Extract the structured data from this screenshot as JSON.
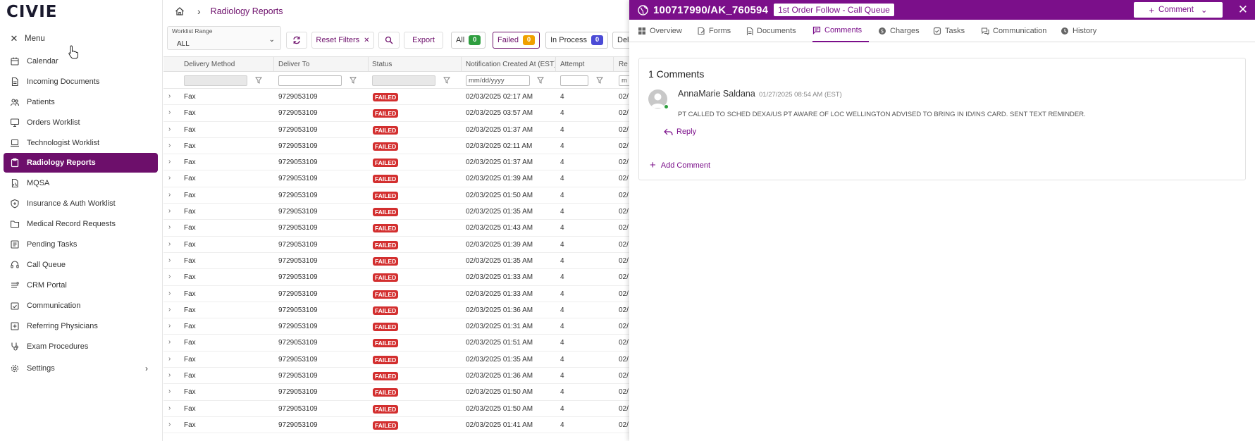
{
  "sidebar": {
    "logo": "CIVIE",
    "menu_label": "Menu",
    "items": [
      {
        "label": "Calendar",
        "icon": "calendar-icon"
      },
      {
        "label": "Incoming Documents",
        "icon": "document-icon"
      },
      {
        "label": "Patients",
        "icon": "users-icon"
      },
      {
        "label": "Orders Worklist",
        "icon": "monitor-icon"
      },
      {
        "label": "Technologist Worklist",
        "icon": "laptop-icon"
      },
      {
        "label": "Radiology Reports",
        "icon": "clipboard-icon",
        "active": true
      },
      {
        "label": "MQSA",
        "icon": "file-chart-icon"
      },
      {
        "label": "Insurance & Auth Worklist",
        "icon": "shield-icon"
      },
      {
        "label": "Medical Record Requests",
        "icon": "folder-icon"
      },
      {
        "label": "Pending Tasks",
        "icon": "list-icon"
      },
      {
        "label": "Call Queue",
        "icon": "headset-icon"
      },
      {
        "label": "CRM Portal",
        "icon": "portal-icon"
      },
      {
        "label": "Communication",
        "icon": "calendar-check-icon"
      },
      {
        "label": "Referring Physicians",
        "icon": "plus-square-icon"
      },
      {
        "label": "Exam Procedures",
        "icon": "stethoscope-icon"
      },
      {
        "label": "Settings",
        "icon": "gear-icon"
      }
    ]
  },
  "header": {
    "title": "Radiology Reports"
  },
  "filters": {
    "worklist_range_label": "Worklist Range",
    "worklist_range_value": "ALL",
    "reset_label": "Reset Filters",
    "export_label": "Export",
    "chips": [
      {
        "label": "All",
        "count": "0",
        "color": "#2e9e3f"
      },
      {
        "label": "Failed",
        "count": "0",
        "color": "#f0a000"
      },
      {
        "label": "In Process",
        "count": "0",
        "color": "#4b4bd6"
      },
      {
        "label": "Del",
        "count": ""
      }
    ]
  },
  "table": {
    "columns": [
      "Delivery Method",
      "Deliver To",
      "Status",
      "Notification Created At (EST)",
      "Attempt",
      "Re"
    ],
    "date_placeholder": "mm/dd/yyyy",
    "partial_filter": "m",
    "rows": [
      {
        "method": "Fax",
        "to": "9729053109",
        "status": "FAILED",
        "created": "02/03/2025 02:17 AM",
        "attempt": "4",
        "extra": "02/"
      },
      {
        "method": "Fax",
        "to": "9729053109",
        "status": "FAILED",
        "created": "02/03/2025 03:57 AM",
        "attempt": "4",
        "extra": "02/"
      },
      {
        "method": "Fax",
        "to": "9729053109",
        "status": "FAILED",
        "created": "02/03/2025 01:37 AM",
        "attempt": "4",
        "extra": "02/"
      },
      {
        "method": "Fax",
        "to": "9729053109",
        "status": "FAILED",
        "created": "02/03/2025 02:11 AM",
        "attempt": "4",
        "extra": "02/"
      },
      {
        "method": "Fax",
        "to": "9729053109",
        "status": "FAILED",
        "created": "02/03/2025 01:37 AM",
        "attempt": "4",
        "extra": "02/"
      },
      {
        "method": "Fax",
        "to": "9729053109",
        "status": "FAILED",
        "created": "02/03/2025 01:39 AM",
        "attempt": "4",
        "extra": "02/"
      },
      {
        "method": "Fax",
        "to": "9729053109",
        "status": "FAILED",
        "created": "02/03/2025 01:50 AM",
        "attempt": "4",
        "extra": "02/"
      },
      {
        "method": "Fax",
        "to": "9729053109",
        "status": "FAILED",
        "created": "02/03/2025 01:35 AM",
        "attempt": "4",
        "extra": "02/"
      },
      {
        "method": "Fax",
        "to": "9729053109",
        "status": "FAILED",
        "created": "02/03/2025 01:43 AM",
        "attempt": "4",
        "extra": "02/"
      },
      {
        "method": "Fax",
        "to": "9729053109",
        "status": "FAILED",
        "created": "02/03/2025 01:39 AM",
        "attempt": "4",
        "extra": "02/"
      },
      {
        "method": "Fax",
        "to": "9729053109",
        "status": "FAILED",
        "created": "02/03/2025 01:35 AM",
        "attempt": "4",
        "extra": "02/"
      },
      {
        "method": "Fax",
        "to": "9729053109",
        "status": "FAILED",
        "created": "02/03/2025 01:33 AM",
        "attempt": "4",
        "extra": "02/"
      },
      {
        "method": "Fax",
        "to": "9729053109",
        "status": "FAILED",
        "created": "02/03/2025 01:33 AM",
        "attempt": "4",
        "extra": "02/"
      },
      {
        "method": "Fax",
        "to": "9729053109",
        "status": "FAILED",
        "created": "02/03/2025 01:36 AM",
        "attempt": "4",
        "extra": "02/"
      },
      {
        "method": "Fax",
        "to": "9729053109",
        "status": "FAILED",
        "created": "02/03/2025 01:31 AM",
        "attempt": "4",
        "extra": "02/"
      },
      {
        "method": "Fax",
        "to": "9729053109",
        "status": "FAILED",
        "created": "02/03/2025 01:51 AM",
        "attempt": "4",
        "extra": "02/"
      },
      {
        "method": "Fax",
        "to": "9729053109",
        "status": "FAILED",
        "created": "02/03/2025 01:35 AM",
        "attempt": "4",
        "extra": "02/"
      },
      {
        "method": "Fax",
        "to": "9729053109",
        "status": "FAILED",
        "created": "02/03/2025 01:36 AM",
        "attempt": "4",
        "extra": "02/"
      },
      {
        "method": "Fax",
        "to": "9729053109",
        "status": "FAILED",
        "created": "02/03/2025 01:50 AM",
        "attempt": "4",
        "extra": "02/"
      },
      {
        "method": "Fax",
        "to": "9729053109",
        "status": "FAILED",
        "created": "02/03/2025 01:50 AM",
        "attempt": "4",
        "extra": "02/"
      },
      {
        "method": "Fax",
        "to": "9729053109",
        "status": "FAILED",
        "created": "02/03/2025 01:41 AM",
        "attempt": "4",
        "extra": "02/"
      }
    ]
  },
  "panel": {
    "id": "100717990/AK_760594",
    "queue_tag": "1st Order Follow - Call Queue",
    "comment_button": "Comment",
    "tabs": [
      {
        "label": "Overview",
        "icon": "grid-icon"
      },
      {
        "label": "Forms",
        "icon": "form-icon"
      },
      {
        "label": "Documents",
        "icon": "document-icon"
      },
      {
        "label": "Comments",
        "icon": "comment-icon",
        "active": true
      },
      {
        "label": "Charges",
        "icon": "dollar-icon"
      },
      {
        "label": "Tasks",
        "icon": "tasks-icon"
      },
      {
        "label": "Communication",
        "icon": "chat-icon"
      },
      {
        "label": "History",
        "icon": "history-icon"
      }
    ],
    "comments_title": "1 Comments",
    "comment": {
      "author": "AnnaMarie Saldana",
      "time": "01/27/2025 08:54 AM (EST)",
      "text": "PT CALLED TO SCHED DEXA/US PT AWARE OF LOC WELLINGTON ADVISED TO BRING IN ID/INS CARD. SENT TEXT REMINDER.",
      "reply_label": "Reply"
    },
    "add_comment_label": "Add Comment"
  }
}
